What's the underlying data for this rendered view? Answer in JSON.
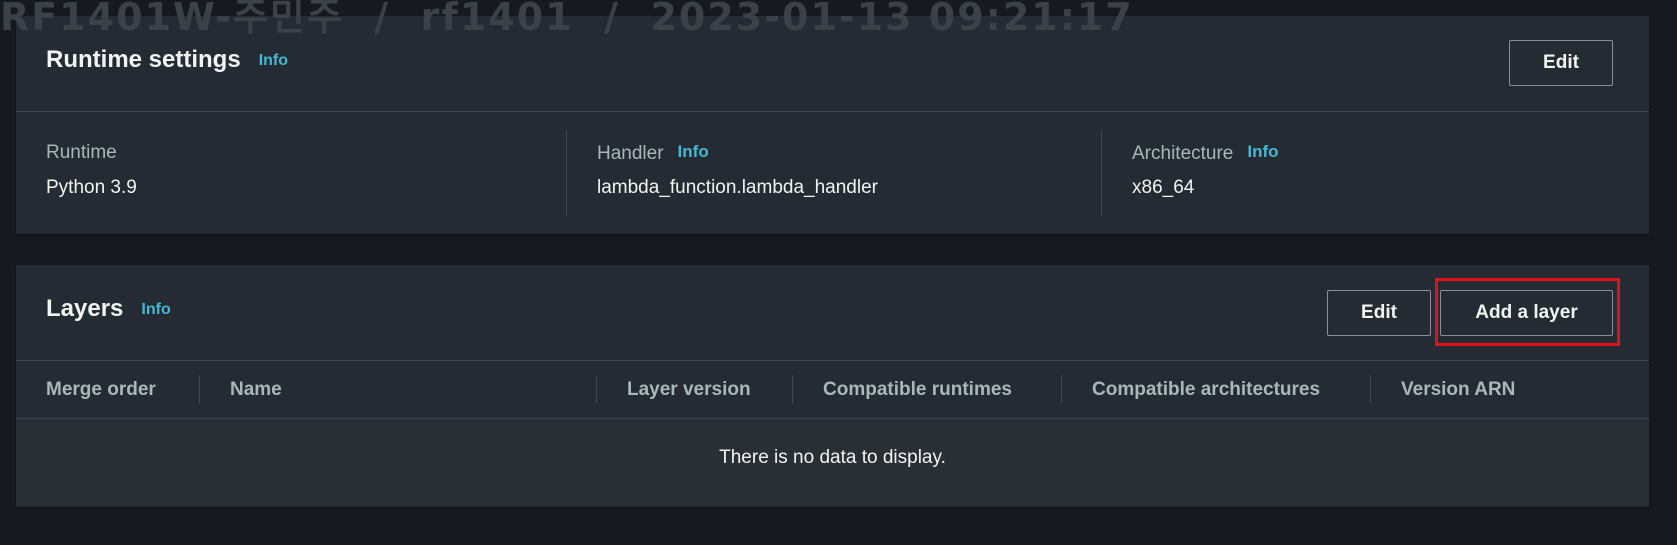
{
  "watermark": "RF1401W-주민주  /  rf1401  /  2023-01-13 09:21:17",
  "runtime_settings": {
    "title": "Runtime settings",
    "info": "Info",
    "edit_label": "Edit",
    "runtime": {
      "label": "Runtime",
      "value": "Python 3.9"
    },
    "handler": {
      "label": "Handler",
      "info": "Info",
      "value": "lambda_function.lambda_handler"
    },
    "architecture": {
      "label": "Architecture",
      "info": "Info",
      "value": "x86_64"
    }
  },
  "layers": {
    "title": "Layers",
    "info": "Info",
    "edit_label": "Edit",
    "add_label": "Add a layer",
    "highlight_color": "#e0101c",
    "columns": [
      "Merge order",
      "Name",
      "Layer version",
      "Compatible runtimes",
      "Compatible architectures",
      "Version ARN"
    ],
    "empty_message": "There is no data to display."
  },
  "colors": {
    "background": "#16191f",
    "panel": "#252b33",
    "link": "#44b9d6",
    "text": "#f2f3f3",
    "muted": "#aab7b8"
  }
}
